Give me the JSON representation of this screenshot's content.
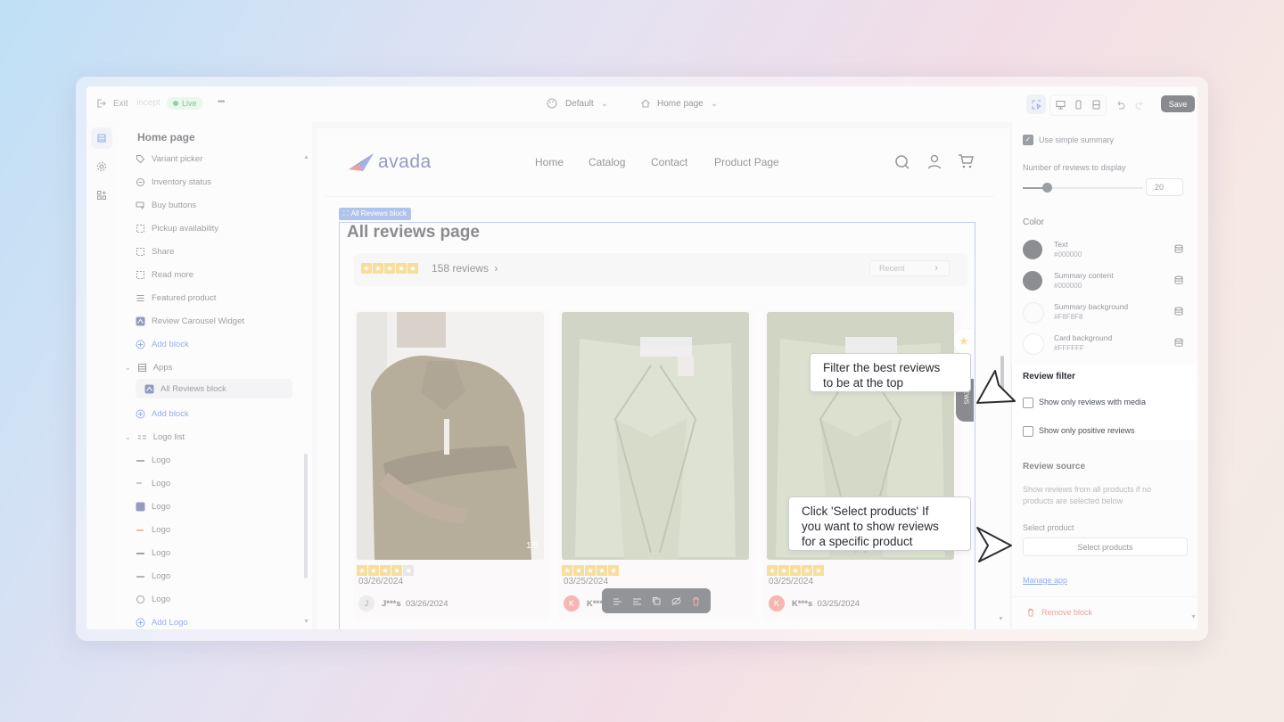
{
  "topbar": {
    "exit_label": "Exit",
    "store_label": "incept",
    "live_label": "Live",
    "more_label": "•••",
    "theme_label": "Default",
    "page_label": "Home page",
    "save_label": "Save"
  },
  "sidebar": {
    "title": "Home page",
    "items": [
      {
        "label": "Variant picker",
        "icon": "tag-icon"
      },
      {
        "label": "Inventory status",
        "icon": "inventory-icon"
      },
      {
        "label": "Buy buttons",
        "icon": "cursor-icon"
      },
      {
        "label": "Pickup availability",
        "icon": "dashed-box-icon"
      },
      {
        "label": "Share",
        "icon": "dashed-box-icon"
      },
      {
        "label": "Read more",
        "icon": "dashed-box-icon"
      },
      {
        "label": "Featured product",
        "icon": "list-icon"
      },
      {
        "label": "Review Carousel Widget",
        "icon": "app-icon"
      },
      {
        "label": "Add block",
        "icon": "plus-icon"
      },
      {
        "label": "Apps",
        "icon": "apps-icon"
      },
      {
        "label": "All Reviews block",
        "icon": "app-icon"
      },
      {
        "label": "Add block",
        "icon": "plus-icon"
      },
      {
        "label": "Logo list",
        "icon": "logo-list-icon"
      },
      {
        "label": "Logo",
        "icon": "logo-icon"
      },
      {
        "label": "Logo",
        "icon": "logo-icon"
      },
      {
        "label": "Logo",
        "icon": "logo-icon"
      },
      {
        "label": "Logo",
        "icon": "logo-icon"
      },
      {
        "label": "Logo",
        "icon": "logo-icon"
      },
      {
        "label": "Logo",
        "icon": "logo-icon"
      },
      {
        "label": "Logo",
        "icon": "logo-icon"
      },
      {
        "label": "Add Logo",
        "icon": "plus-icon"
      }
    ]
  },
  "store": {
    "brand": "avada",
    "nav": [
      "Home",
      "Catalog",
      "Contact",
      "Product Page"
    ],
    "block_label": "All Reviews block",
    "heading": "All reviews page",
    "rating_count": "158 reviews",
    "rating_stars": 5,
    "sort_label": "Recent",
    "side_tab": "EWS",
    "cards": [
      {
        "date": "03/26/2024",
        "stars": 4,
        "avatar": "J",
        "reviewer": "J***s",
        "reviewer_date": "03/26/2024",
        "counter": "1/5",
        "avatar_color": "#dcdcdf"
      },
      {
        "date": "03/25/2024",
        "stars": 5,
        "avatar": "K",
        "reviewer": "K***",
        "reviewer_date": "",
        "counter": "",
        "avatar_color": "#ef7a72"
      },
      {
        "date": "03/25/2024",
        "stars": 5,
        "avatar": "K",
        "reviewer": "K***s",
        "reviewer_date": "03/25/2024",
        "counter": "",
        "avatar_color": "#ef7a72"
      }
    ]
  },
  "panel": {
    "simple_summary_label": "Use simple summary",
    "num_reviews_label": "Number of reviews to display",
    "num_reviews_value": "20",
    "slider_fraction": 0.2,
    "color_heading": "Color",
    "colors": [
      {
        "name": "Text",
        "hex": "#000000",
        "swatch": "#2f3136"
      },
      {
        "name": "Summary content",
        "hex": "#000000",
        "swatch": "#2f3136"
      },
      {
        "name": "Summary background",
        "hex": "#F8F8F8",
        "swatch": "#f8f8f8"
      },
      {
        "name": "Card background",
        "hex": "#FFFFFF",
        "swatch": "#ffffff"
      }
    ],
    "filter_heading": "Review filter",
    "filter_media_label": "Show only reviews with media",
    "filter_positive_label": "Show only positive reviews",
    "source_heading": "Review source",
    "source_desc_1": "Show reviews from all products if no",
    "source_desc_2": "products are selected below",
    "select_product_label": "Select product",
    "select_products_button": "Select products",
    "manage_app_link": "Manage app",
    "remove_block_label": "Remove block"
  },
  "callouts": {
    "filter_line1": "Filter the best reviews",
    "filter_line2": "to be at the top",
    "select_line1": "Click 'Select products' If",
    "select_line2": "you want to show reviews",
    "select_line3": "for a specific product"
  },
  "colors": {
    "accent": "#3a6fd8",
    "star": "#f2c14a",
    "save_button": "#2b2d33",
    "live_badge": "#d6f3dd"
  }
}
